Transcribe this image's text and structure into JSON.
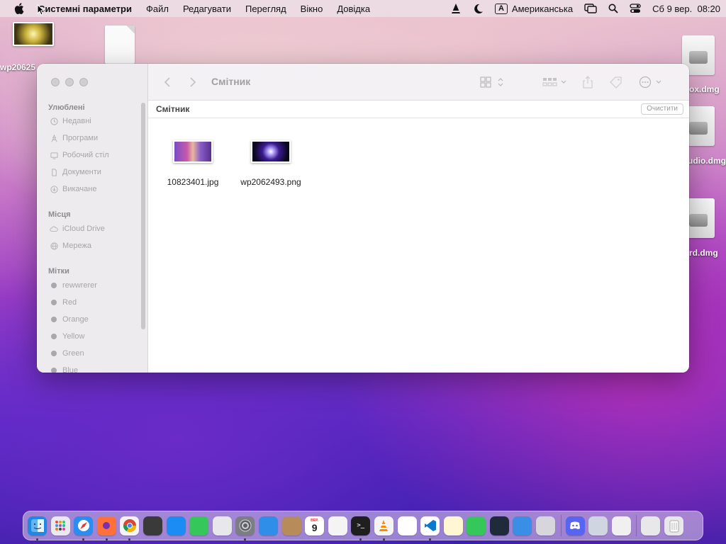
{
  "menubar": {
    "apple_icon": "apple-logo-icon",
    "app_name": "Системні параметри",
    "menus": [
      "Файл",
      "Редагувати",
      "Перегляд",
      "Вікно",
      "Довідка"
    ],
    "input_source_letter": "A",
    "input_source": "Американська",
    "datetime": "Сб 9 вер.  08:20"
  },
  "desktop": {
    "items": [
      {
        "label": "wp20625",
        "icon": "image-thumbnail"
      },
      {
        "label": "",
        "icon": "document-icon"
      },
      {
        "label": "ox.dmg",
        "icon": "disk-image-icon"
      },
      {
        "label": "udio.dmg",
        "icon": "disk-image-icon"
      },
      {
        "label": "rd.dmg",
        "icon": "disk-image-icon"
      }
    ]
  },
  "finder": {
    "window_title": "Смітник",
    "location_title": "Смітник",
    "empty_button": "Очистити",
    "sidebar": {
      "favorites_header": "Улюблені",
      "favorites": [
        {
          "label": "Недавні",
          "icon": "clock-icon"
        },
        {
          "label": "Програми",
          "icon": "apps-icon"
        },
        {
          "label": "Робочий стіл",
          "icon": "desktop-icon"
        },
        {
          "label": "Документи",
          "icon": "document-icon"
        },
        {
          "label": "Викачане",
          "icon": "download-icon"
        }
      ],
      "locations_header": "Місця",
      "locations": [
        {
          "label": "iCloud Drive",
          "icon": "cloud-icon"
        },
        {
          "label": "Мережа",
          "icon": "globe-icon"
        }
      ],
      "tags_header": "Мітки",
      "tags": [
        {
          "label": "rewwrerer"
        },
        {
          "label": "Red"
        },
        {
          "label": "Orange"
        },
        {
          "label": "Yellow"
        },
        {
          "label": "Green"
        },
        {
          "label": "Blue"
        }
      ]
    },
    "files": [
      {
        "name": "10823401.jpg"
      },
      {
        "name": "wp2062493.png"
      }
    ]
  },
  "dock": {
    "apps": [
      {
        "name": "Finder",
        "color": "#1e88e5",
        "running": true
      },
      {
        "name": "Launchpad",
        "color": "#e9e9ef",
        "running": false
      },
      {
        "name": "Safari",
        "color": "#2d8cf0",
        "running": true
      },
      {
        "name": "Firefox",
        "color": "#ff7139",
        "running": true
      },
      {
        "name": "Chrome",
        "color": "#f4f4f4",
        "running": true
      },
      {
        "name": "Instruments",
        "color": "#3a3a3a",
        "running": false
      },
      {
        "name": "App Store",
        "color": "#1c8cf5",
        "running": false
      },
      {
        "name": "Messages",
        "color": "#35c759",
        "running": false
      },
      {
        "name": "Maps",
        "color": "#e8e8ec",
        "running": false
      },
      {
        "name": "System Settings",
        "color": "#7d7d84",
        "running": true
      },
      {
        "name": "Mail",
        "color": "#2f8fe8",
        "running": false
      },
      {
        "name": "Contacts",
        "color": "#b78c5a",
        "running": false
      },
      {
        "name": "Calendar",
        "color": "#ffffff",
        "running": false
      },
      {
        "name": "TextEdit",
        "color": "#f4f4f4",
        "running": false
      },
      {
        "name": "Terminal",
        "color": "#1f1f1f",
        "running": true
      },
      {
        "name": "VLC",
        "color": "#f4f4f4",
        "running": true
      },
      {
        "name": "Reminders",
        "color": "#ffffff",
        "running": false
      },
      {
        "name": "VS Code",
        "color": "#ffffff",
        "running": true
      },
      {
        "name": "Notes",
        "color": "#fff7d1",
        "running": false
      },
      {
        "name": "FaceTime",
        "color": "#35c759",
        "running": false
      },
      {
        "name": "QuickTime",
        "color": "#1f2b3a",
        "running": false
      },
      {
        "name": "Xcode",
        "color": "#3a8ee6",
        "running": false
      },
      {
        "name": "Preview",
        "color": "#d6d6dc",
        "running": false
      },
      {
        "name": "Discord",
        "color": "#5865f2",
        "running": false
      },
      {
        "name": "Screen Sharing",
        "color": "#cfd6e2",
        "running": false
      },
      {
        "name": "Printer",
        "color": "#f0f0f0",
        "running": false
      },
      {
        "name": "Folder",
        "color": "#e8e8ea",
        "running": false
      },
      {
        "name": "Trash",
        "color": "#e8e8ea",
        "running": false
      }
    ],
    "calendar_day": "9",
    "calendar_month": "ВЕР."
  }
}
